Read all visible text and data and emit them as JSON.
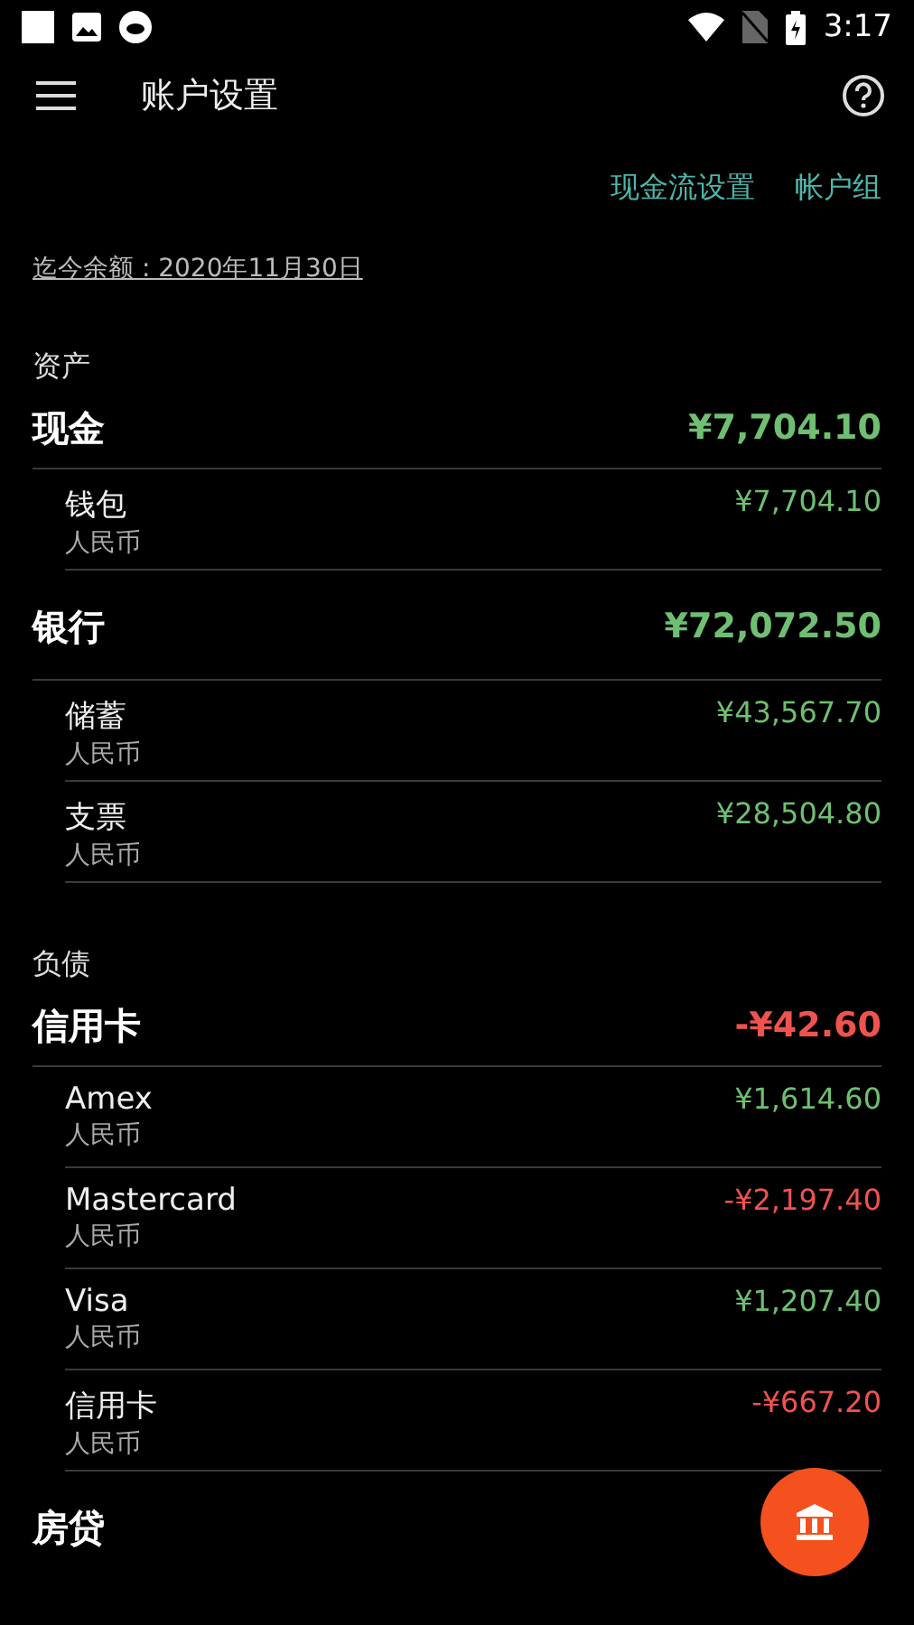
{
  "status_bar": {
    "time": "3:17"
  },
  "app_bar": {
    "title": "账户设置"
  },
  "links": [
    "现金流设置",
    "帐户组"
  ],
  "balance_date": "迄今余额 : 2020年11月30日",
  "sections": [
    {
      "title": "资产",
      "groups": [
        {
          "name": "现金",
          "total": "¥7,704.10",
          "negative": false,
          "accounts": [
            {
              "name": "钱包",
              "currency": "人民币",
              "amount": "¥7,704.10",
              "negative": false
            }
          ]
        },
        {
          "name": "银行",
          "total": "¥72,072.50",
          "negative": false,
          "accounts": [
            {
              "name": "储蓄",
              "currency": "人民币",
              "amount": "¥43,567.70",
              "negative": false
            },
            {
              "name": "支票",
              "currency": "人民币",
              "amount": "¥28,504.80",
              "negative": false
            }
          ]
        }
      ]
    },
    {
      "title": "负债",
      "groups": [
        {
          "name": "信用卡",
          "total": "-¥42.60",
          "negative": true,
          "accounts": [
            {
              "name": "Amex",
              "currency": "人民币",
              "amount": "¥1,614.60",
              "negative": false
            },
            {
              "name": "Mastercard",
              "currency": "人民币",
              "amount": "-¥2,197.40",
              "negative": true
            },
            {
              "name": "Visa",
              "currency": "人民币",
              "amount": "¥1,207.40",
              "negative": false
            },
            {
              "name": "信用卡",
              "currency": "人民币",
              "amount": "-¥667.20",
              "negative": true
            }
          ]
        },
        {
          "name": "房贷"
        }
      ]
    }
  ]
}
